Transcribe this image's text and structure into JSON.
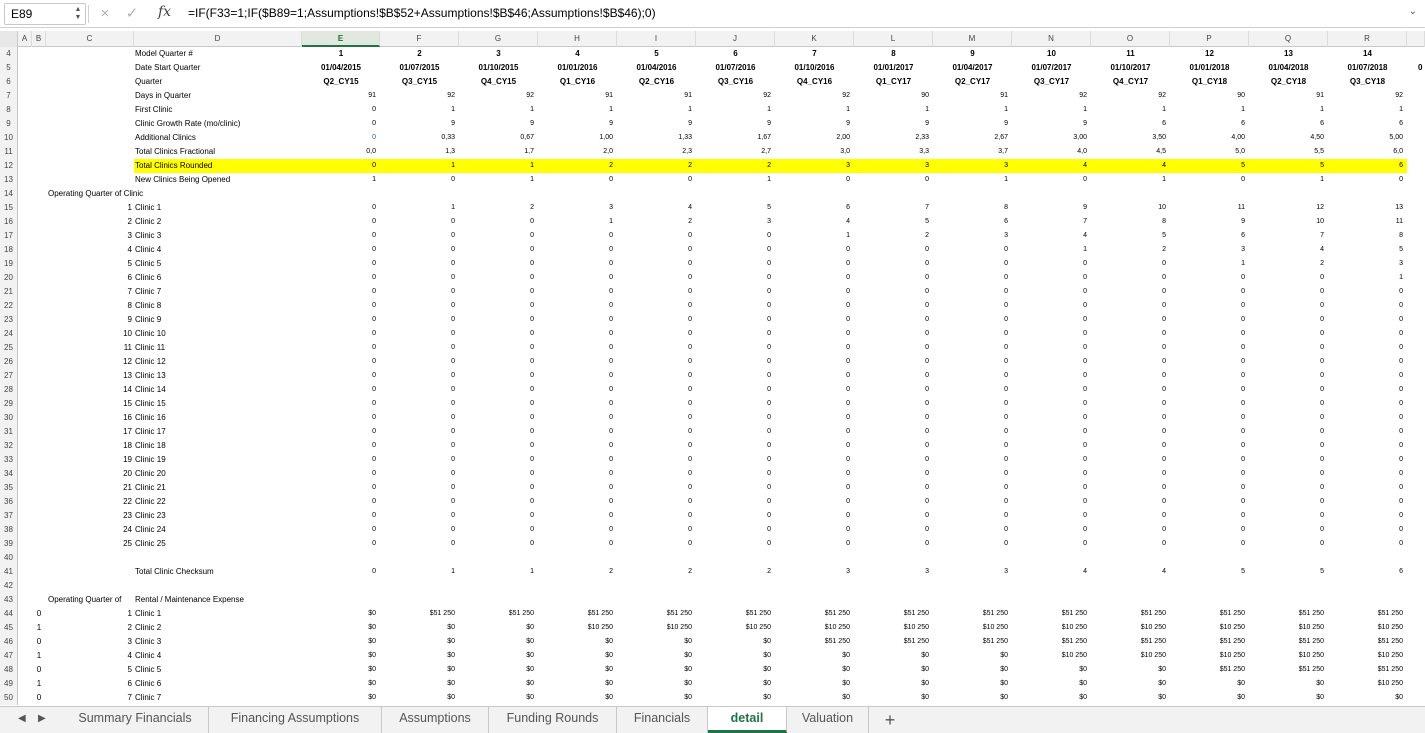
{
  "formula_bar": {
    "name_box": "E89",
    "cancel_icon": "×",
    "enter_icon": "✓",
    "fx": "fx",
    "formula": "=IF(F33=1;IF($B89=1;Assumptions!$B$52+Assumptions!$B$46;Assumptions!$B$46);0)"
  },
  "columns": [
    {
      "id": "A",
      "label": "A",
      "selected": false
    },
    {
      "id": "B",
      "label": "B",
      "selected": false
    },
    {
      "id": "C",
      "label": "C",
      "selected": false
    },
    {
      "id": "D",
      "label": "D",
      "selected": false
    },
    {
      "id": "E",
      "label": "E",
      "selected": true
    },
    {
      "id": "F",
      "label": "F",
      "selected": false
    },
    {
      "id": "G",
      "label": "G",
      "selected": false
    },
    {
      "id": "H",
      "label": "H",
      "selected": false
    },
    {
      "id": "I",
      "label": "I",
      "selected": false
    },
    {
      "id": "J",
      "label": "J",
      "selected": false
    },
    {
      "id": "K",
      "label": "K",
      "selected": false
    },
    {
      "id": "L",
      "label": "L",
      "selected": false
    },
    {
      "id": "M",
      "label": "M",
      "selected": false
    },
    {
      "id": "N",
      "label": "N",
      "selected": false
    },
    {
      "id": "O",
      "label": "O",
      "selected": false
    },
    {
      "id": "P",
      "label": "P",
      "selected": false
    },
    {
      "id": "Q",
      "label": "Q",
      "selected": false
    },
    {
      "id": "R",
      "label": "R",
      "selected": false
    }
  ],
  "overflow_cell": "0",
  "rows": [
    {
      "n": "4",
      "b": "",
      "c": "",
      "d": "Model Quarter #",
      "style": "hdr",
      "vals": [
        "1",
        "2",
        "3",
        "4",
        "5",
        "6",
        "7",
        "8",
        "9",
        "10",
        "11",
        "12",
        "13",
        "14"
      ]
    },
    {
      "n": "5",
      "b": "",
      "c": "",
      "d": "Date Start Quarter",
      "style": "hdr",
      "vals": [
        "01/04/2015",
        "01/07/2015",
        "01/10/2015",
        "01/01/2016",
        "01/04/2016",
        "01/07/2016",
        "01/10/2016",
        "01/01/2017",
        "01/04/2017",
        "01/07/2017",
        "01/10/2017",
        "01/01/2018",
        "01/04/2018",
        "01/07/2018"
      ]
    },
    {
      "n": "6",
      "b": "",
      "c": "",
      "d": "Quarter",
      "style": "hdr",
      "vals": [
        "Q2_CY15",
        "Q3_CY15",
        "Q4_CY15",
        "Q1_CY16",
        "Q2_CY16",
        "Q3_CY16",
        "Q4_CY16",
        "Q1_CY17",
        "Q2_CY17",
        "Q3_CY17",
        "Q4_CY17",
        "Q1_CY18",
        "Q2_CY18",
        "Q3_CY18"
      ]
    },
    {
      "n": "7",
      "b": "",
      "c": "",
      "d": "Days in Quarter",
      "style": "num",
      "vals": [
        "91",
        "92",
        "92",
        "91",
        "91",
        "92",
        "92",
        "90",
        "91",
        "92",
        "92",
        "90",
        "91",
        "92"
      ]
    },
    {
      "n": "8",
      "b": "",
      "c": "",
      "d": "First Clinic",
      "style": "num",
      "vals": [
        "0",
        "1",
        "1",
        "1",
        "1",
        "1",
        "1",
        "1",
        "1",
        "1",
        "1",
        "1",
        "1",
        "1"
      ]
    },
    {
      "n": "9",
      "b": "",
      "c": "",
      "d": "Clinic Growth Rate (mo/clinic)",
      "style": "num",
      "vals": [
        "0",
        "9",
        "9",
        "9",
        "9",
        "9",
        "9",
        "9",
        "9",
        "9",
        "6",
        "6",
        "6",
        "6"
      ]
    },
    {
      "n": "10",
      "b": "",
      "c": "",
      "d": "Additional Clinics",
      "style": "num",
      "blue_first": true,
      "vals": [
        "0",
        "0,33",
        "0,67",
        "1,00",
        "1,33",
        "1,67",
        "2,00",
        "2,33",
        "2,67",
        "3,00",
        "3,50",
        "4,00",
        "4,50",
        "5,00"
      ]
    },
    {
      "n": "11",
      "b": "",
      "c": "",
      "d": "Total Clinics Fractional",
      "style": "num",
      "vals": [
        "0,0",
        "1,3",
        "1,7",
        "2,0",
        "2,3",
        "2,7",
        "3,0",
        "3,3",
        "3,7",
        "4,0",
        "4,5",
        "5,0",
        "5,5",
        "6,0"
      ]
    },
    {
      "n": "12",
      "b": "",
      "c": "",
      "d": "Total Clinics Rounded",
      "style": "num",
      "highlight": true,
      "vals": [
        "0",
        "1",
        "1",
        "2",
        "2",
        "2",
        "3",
        "3",
        "3",
        "4",
        "4",
        "5",
        "5",
        "6"
      ]
    },
    {
      "n": "13",
      "b": "",
      "c": "",
      "d": "New Clinics Being Opened",
      "style": "num",
      "vals": [
        "1",
        "0",
        "1",
        "0",
        "0",
        "1",
        "0",
        "0",
        "1",
        "0",
        "1",
        "0",
        "1",
        "0"
      ]
    },
    {
      "n": "14",
      "b": "",
      "c": "Operating Quarter of Clinic",
      "d": "",
      "style": "num",
      "vals": []
    },
    {
      "n": "15",
      "b": "",
      "c": "1",
      "d": "Clinic 1",
      "style": "num",
      "vals": [
        "0",
        "1",
        "2",
        "3",
        "4",
        "5",
        "6",
        "7",
        "8",
        "9",
        "10",
        "11",
        "12",
        "13"
      ]
    },
    {
      "n": "16",
      "b": "",
      "c": "2",
      "d": "Clinic 2",
      "style": "num",
      "vals": [
        "0",
        "0",
        "0",
        "1",
        "2",
        "3",
        "4",
        "5",
        "6",
        "7",
        "8",
        "9",
        "10",
        "11"
      ]
    },
    {
      "n": "17",
      "b": "",
      "c": "3",
      "d": "Clinic 3",
      "style": "num",
      "vals": [
        "0",
        "0",
        "0",
        "0",
        "0",
        "0",
        "1",
        "2",
        "3",
        "4",
        "5",
        "6",
        "7",
        "8"
      ]
    },
    {
      "n": "18",
      "b": "",
      "c": "4",
      "d": "Clinic 4",
      "style": "num",
      "vals": [
        "0",
        "0",
        "0",
        "0",
        "0",
        "0",
        "0",
        "0",
        "0",
        "1",
        "2",
        "3",
        "4",
        "5"
      ]
    },
    {
      "n": "19",
      "b": "",
      "c": "5",
      "d": "Clinic 5",
      "style": "num",
      "vals": [
        "0",
        "0",
        "0",
        "0",
        "0",
        "0",
        "0",
        "0",
        "0",
        "0",
        "0",
        "1",
        "2",
        "3"
      ]
    },
    {
      "n": "20",
      "b": "",
      "c": "6",
      "d": "Clinic 6",
      "style": "num",
      "vals": [
        "0",
        "0",
        "0",
        "0",
        "0",
        "0",
        "0",
        "0",
        "0",
        "0",
        "0",
        "0",
        "0",
        "1"
      ]
    },
    {
      "n": "21",
      "b": "",
      "c": "7",
      "d": "Clinic 7",
      "style": "num",
      "vals": [
        "0",
        "0",
        "0",
        "0",
        "0",
        "0",
        "0",
        "0",
        "0",
        "0",
        "0",
        "0",
        "0",
        "0"
      ]
    },
    {
      "n": "22",
      "b": "",
      "c": "8",
      "d": "Clinic 8",
      "style": "num",
      "vals": [
        "0",
        "0",
        "0",
        "0",
        "0",
        "0",
        "0",
        "0",
        "0",
        "0",
        "0",
        "0",
        "0",
        "0"
      ]
    },
    {
      "n": "23",
      "b": "",
      "c": "9",
      "d": "Clinic 9",
      "style": "num",
      "vals": [
        "0",
        "0",
        "0",
        "0",
        "0",
        "0",
        "0",
        "0",
        "0",
        "0",
        "0",
        "0",
        "0",
        "0"
      ]
    },
    {
      "n": "24",
      "b": "",
      "c": "10",
      "d": "Clinic 10",
      "style": "num",
      "vals": [
        "0",
        "0",
        "0",
        "0",
        "0",
        "0",
        "0",
        "0",
        "0",
        "0",
        "0",
        "0",
        "0",
        "0"
      ]
    },
    {
      "n": "25",
      "b": "",
      "c": "11",
      "d": "Clinic 11",
      "style": "num",
      "vals": [
        "0",
        "0",
        "0",
        "0",
        "0",
        "0",
        "0",
        "0",
        "0",
        "0",
        "0",
        "0",
        "0",
        "0"
      ]
    },
    {
      "n": "26",
      "b": "",
      "c": "12",
      "d": "Clinic 12",
      "style": "num",
      "vals": [
        "0",
        "0",
        "0",
        "0",
        "0",
        "0",
        "0",
        "0",
        "0",
        "0",
        "0",
        "0",
        "0",
        "0"
      ]
    },
    {
      "n": "27",
      "b": "",
      "c": "13",
      "d": "Clinic 13",
      "style": "num",
      "vals": [
        "0",
        "0",
        "0",
        "0",
        "0",
        "0",
        "0",
        "0",
        "0",
        "0",
        "0",
        "0",
        "0",
        "0"
      ]
    },
    {
      "n": "28",
      "b": "",
      "c": "14",
      "d": "Clinic 14",
      "style": "num",
      "vals": [
        "0",
        "0",
        "0",
        "0",
        "0",
        "0",
        "0",
        "0",
        "0",
        "0",
        "0",
        "0",
        "0",
        "0"
      ]
    },
    {
      "n": "29",
      "b": "",
      "c": "15",
      "d": "Clinic 15",
      "style": "num",
      "vals": [
        "0",
        "0",
        "0",
        "0",
        "0",
        "0",
        "0",
        "0",
        "0",
        "0",
        "0",
        "0",
        "0",
        "0"
      ]
    },
    {
      "n": "30",
      "b": "",
      "c": "16",
      "d": "Clinic 16",
      "style": "num",
      "vals": [
        "0",
        "0",
        "0",
        "0",
        "0",
        "0",
        "0",
        "0",
        "0",
        "0",
        "0",
        "0",
        "0",
        "0"
      ]
    },
    {
      "n": "31",
      "b": "",
      "c": "17",
      "d": "Clinic 17",
      "style": "num",
      "vals": [
        "0",
        "0",
        "0",
        "0",
        "0",
        "0",
        "0",
        "0",
        "0",
        "0",
        "0",
        "0",
        "0",
        "0"
      ]
    },
    {
      "n": "32",
      "b": "",
      "c": "18",
      "d": "Clinic 18",
      "style": "num",
      "vals": [
        "0",
        "0",
        "0",
        "0",
        "0",
        "0",
        "0",
        "0",
        "0",
        "0",
        "0",
        "0",
        "0",
        "0"
      ]
    },
    {
      "n": "33",
      "b": "",
      "c": "19",
      "d": "Clinic 19",
      "style": "num",
      "vals": [
        "0",
        "0",
        "0",
        "0",
        "0",
        "0",
        "0",
        "0",
        "0",
        "0",
        "0",
        "0",
        "0",
        "0"
      ]
    },
    {
      "n": "34",
      "b": "",
      "c": "20",
      "d": "Clinic 20",
      "style": "num",
      "vals": [
        "0",
        "0",
        "0",
        "0",
        "0",
        "0",
        "0",
        "0",
        "0",
        "0",
        "0",
        "0",
        "0",
        "0"
      ]
    },
    {
      "n": "35",
      "b": "",
      "c": "21",
      "d": "Clinic 21",
      "style": "num",
      "vals": [
        "0",
        "0",
        "0",
        "0",
        "0",
        "0",
        "0",
        "0",
        "0",
        "0",
        "0",
        "0",
        "0",
        "0"
      ]
    },
    {
      "n": "36",
      "b": "",
      "c": "22",
      "d": "Clinic 22",
      "style": "num",
      "vals": [
        "0",
        "0",
        "0",
        "0",
        "0",
        "0",
        "0",
        "0",
        "0",
        "0",
        "0",
        "0",
        "0",
        "0"
      ]
    },
    {
      "n": "37",
      "b": "",
      "c": "23",
      "d": "Clinic 23",
      "style": "num",
      "vals": [
        "0",
        "0",
        "0",
        "0",
        "0",
        "0",
        "0",
        "0",
        "0",
        "0",
        "0",
        "0",
        "0",
        "0"
      ]
    },
    {
      "n": "38",
      "b": "",
      "c": "24",
      "d": "Clinic 24",
      "style": "num",
      "vals": [
        "0",
        "0",
        "0",
        "0",
        "0",
        "0",
        "0",
        "0",
        "0",
        "0",
        "0",
        "0",
        "0",
        "0"
      ]
    },
    {
      "n": "39",
      "b": "",
      "c": "25",
      "d": "Clinic 25",
      "style": "num",
      "vals": [
        "0",
        "0",
        "0",
        "0",
        "0",
        "0",
        "0",
        "0",
        "0",
        "0",
        "0",
        "0",
        "0",
        "0"
      ]
    },
    {
      "n": "40",
      "b": "",
      "c": "",
      "d": "",
      "style": "num",
      "vals": []
    },
    {
      "n": "41",
      "b": "",
      "c": "",
      "d": "Total Clinic Checksum",
      "style": "num",
      "vals": [
        "0",
        "1",
        "1",
        "2",
        "2",
        "2",
        "3",
        "3",
        "3",
        "4",
        "4",
        "5",
        "5",
        "6"
      ]
    },
    {
      "n": "42",
      "b": "",
      "c": "",
      "d": "",
      "style": "num",
      "vals": []
    },
    {
      "n": "43",
      "b": "",
      "c": "Operating Quarter of",
      "d": "Rental / Maintenance Expense",
      "style": "num",
      "vals": []
    },
    {
      "n": "44",
      "b": "0",
      "c": "1",
      "d": "Clinic 1",
      "style": "num",
      "vals": [
        "$0",
        "$51 250",
        "$51 250",
        "$51 250",
        "$51 250",
        "$51 250",
        "$51 250",
        "$51 250",
        "$51 250",
        "$51 250",
        "$51 250",
        "$51 250",
        "$51 250",
        "$51 250"
      ]
    },
    {
      "n": "45",
      "b": "1",
      "c": "2",
      "d": "Clinic 2",
      "style": "num",
      "vals": [
        "$0",
        "$0",
        "$0",
        "$10 250",
        "$10 250",
        "$10 250",
        "$10 250",
        "$10 250",
        "$10 250",
        "$10 250",
        "$10 250",
        "$10 250",
        "$10 250",
        "$10 250"
      ]
    },
    {
      "n": "46",
      "b": "0",
      "c": "3",
      "d": "Clinic 3",
      "style": "num",
      "vals": [
        "$0",
        "$0",
        "$0",
        "$0",
        "$0",
        "$0",
        "$51 250",
        "$51 250",
        "$51 250",
        "$51 250",
        "$51 250",
        "$51 250",
        "$51 250",
        "$51 250"
      ]
    },
    {
      "n": "47",
      "b": "1",
      "c": "4",
      "d": "Clinic 4",
      "style": "num",
      "vals": [
        "$0",
        "$0",
        "$0",
        "$0",
        "$0",
        "$0",
        "$0",
        "$0",
        "$0",
        "$10 250",
        "$10 250",
        "$10 250",
        "$10 250",
        "$10 250"
      ]
    },
    {
      "n": "48",
      "b": "0",
      "c": "5",
      "d": "Clinic 5",
      "style": "num",
      "vals": [
        "$0",
        "$0",
        "$0",
        "$0",
        "$0",
        "$0",
        "$0",
        "$0",
        "$0",
        "$0",
        "$0",
        "$51 250",
        "$51 250",
        "$51 250"
      ]
    },
    {
      "n": "49",
      "b": "1",
      "c": "6",
      "d": "Clinic 6",
      "style": "num",
      "vals": [
        "$0",
        "$0",
        "$0",
        "$0",
        "$0",
        "$0",
        "$0",
        "$0",
        "$0",
        "$0",
        "$0",
        "$0",
        "$0",
        "$10 250"
      ]
    },
    {
      "n": "50",
      "b": "0",
      "c": "7",
      "d": "Clinic 7",
      "style": "num",
      "vals": [
        "$0",
        "$0",
        "$0",
        "$0",
        "$0",
        "$0",
        "$0",
        "$0",
        "$0",
        "$0",
        "$0",
        "$0",
        "$0",
        "$0"
      ]
    }
  ],
  "tabs": [
    {
      "label": "Summary Financials",
      "active": false
    },
    {
      "label": "Financing Assumptions",
      "active": false
    },
    {
      "label": "Assumptions",
      "active": false
    },
    {
      "label": "Funding Rounds",
      "active": false
    },
    {
      "label": "Financials",
      "active": false
    },
    {
      "label": "detail",
      "active": true
    },
    {
      "label": "Valuation",
      "active": false
    }
  ],
  "add_sheet": "+",
  "colors": {
    "highlight": "#ffff00",
    "accent": "#217346",
    "blue": "#2a5db0"
  }
}
